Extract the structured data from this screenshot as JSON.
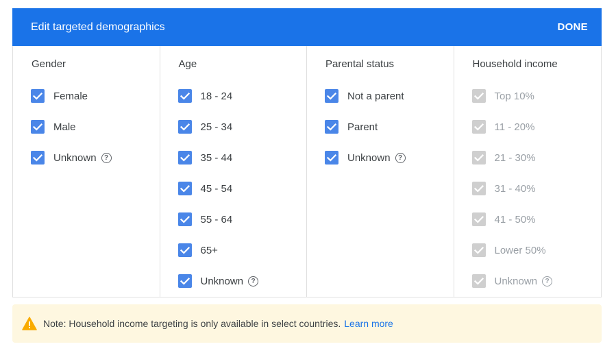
{
  "header": {
    "title": "Edit targeted demographics",
    "done_label": "DONE"
  },
  "columns": [
    {
      "title": "Gender",
      "disabled": false,
      "options": [
        {
          "label": "Female",
          "checked": true,
          "help": false
        },
        {
          "label": "Male",
          "checked": true,
          "help": false
        },
        {
          "label": "Unknown",
          "checked": true,
          "help": true
        }
      ]
    },
    {
      "title": "Age",
      "disabled": false,
      "options": [
        {
          "label": "18 - 24",
          "checked": true,
          "help": false
        },
        {
          "label": "25 - 34",
          "checked": true,
          "help": false
        },
        {
          "label": "35 - 44",
          "checked": true,
          "help": false
        },
        {
          "label": "45 - 54",
          "checked": true,
          "help": false
        },
        {
          "label": "55 - 64",
          "checked": true,
          "help": false
        },
        {
          "label": "65+",
          "checked": true,
          "help": false
        },
        {
          "label": "Unknown",
          "checked": true,
          "help": true
        }
      ]
    },
    {
      "title": "Parental status",
      "disabled": false,
      "options": [
        {
          "label": "Not a parent",
          "checked": true,
          "help": false
        },
        {
          "label": "Parent",
          "checked": true,
          "help": false
        },
        {
          "label": "Unknown",
          "checked": true,
          "help": true
        }
      ]
    },
    {
      "title": "Household income",
      "disabled": true,
      "options": [
        {
          "label": "Top 10%",
          "checked": true,
          "help": false
        },
        {
          "label": "11 - 20%",
          "checked": true,
          "help": false
        },
        {
          "label": "21 - 30%",
          "checked": true,
          "help": false
        },
        {
          "label": "31 - 40%",
          "checked": true,
          "help": false
        },
        {
          "label": "41 - 50%",
          "checked": true,
          "help": false
        },
        {
          "label": "Lower 50%",
          "checked": true,
          "help": false
        },
        {
          "label": "Unknown",
          "checked": true,
          "help": true
        }
      ]
    }
  ],
  "note": {
    "icon": "warning-icon",
    "text": "Note: Household income targeting is only available in select countries.",
    "link_label": "Learn more"
  },
  "colors": {
    "header_bg": "#1a73e8",
    "checkbox_checked": "#4a86e8",
    "checkbox_disabled": "#cfcfcf",
    "note_bg": "#fef7e0",
    "warning": "#f9ab00",
    "link": "#1a73e8"
  }
}
